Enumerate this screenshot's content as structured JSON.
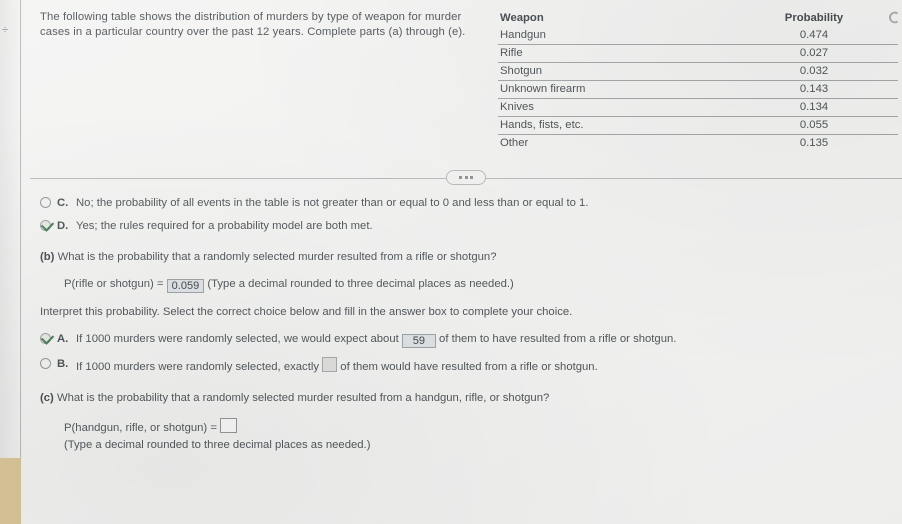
{
  "gutter": {
    "mark": "÷"
  },
  "corner": {
    "icon": "partial-circle-icon"
  },
  "prompt": {
    "text": "The following table shows the distribution of murders by type of weapon for murder cases in a particular country over the past 12 years. Complete parts (a) through (e)."
  },
  "table": {
    "headers": [
      "Weapon",
      "Probability"
    ],
    "rows": [
      {
        "weapon": "Handgun",
        "probability": "0.474"
      },
      {
        "weapon": "Rifle",
        "probability": "0.027"
      },
      {
        "weapon": "Shotgun",
        "probability": "0.032"
      },
      {
        "weapon": "Unknown firearm",
        "probability": "0.143"
      },
      {
        "weapon": "Knives",
        "probability": "0.134"
      },
      {
        "weapon": "Hands, fists, etc.",
        "probability": "0.055"
      },
      {
        "weapon": "Other",
        "probability": "0.135"
      }
    ]
  },
  "separator": {
    "ellipsis_label": "..."
  },
  "part_a_choices": [
    {
      "letter": "C.",
      "text": "No; the probability of all events in the table is not greater than or equal to 0 and less than or equal to 1.",
      "selected": false
    },
    {
      "letter": "D.",
      "text": "Yes; the rules required for a probability model are both met.",
      "selected": true
    }
  ],
  "part_b": {
    "label": "(b)",
    "question": "What is the probability that a randomly selected murder resulted from a rifle or shotgun?",
    "answer_prefix": "P(rifle or shotgun) =",
    "answer_value": "0.059",
    "answer_hint": "(Type a decimal rounded to three decimal places as needed.)",
    "interpret_instruction": "Interpret this probability. Select the correct choice below and fill in the answer box to complete your choice.",
    "choices": [
      {
        "letter": "A.",
        "text_before": "If 1000 murders were randomly selected, we would expect about",
        "box_value": "59",
        "text_after": "of them to have resulted from a rifle or shotgun.",
        "selected": true
      },
      {
        "letter": "B.",
        "text_before": "If 1000 murders were randomly selected, exactly",
        "box_value": "",
        "text_after": "of them would have resulted from a rifle or shotgun.",
        "selected": false
      }
    ]
  },
  "part_c": {
    "label": "(c)",
    "question": "What is the probability that a randomly selected murder resulted from a handgun, rifle, or shotgun?",
    "answer_prefix": "P(handgun, rifle, or shotgun) =",
    "answer_value": "",
    "answer_hint": "(Type a decimal rounded to three decimal places as needed.)"
  },
  "colors": {
    "page_background": "#f4f4f3",
    "gutter_tan": "#ddc58c",
    "check_green": "#3f7a4d",
    "answer_box_fill": "#dfe3e8",
    "rule_line": "#9ea4a8"
  }
}
